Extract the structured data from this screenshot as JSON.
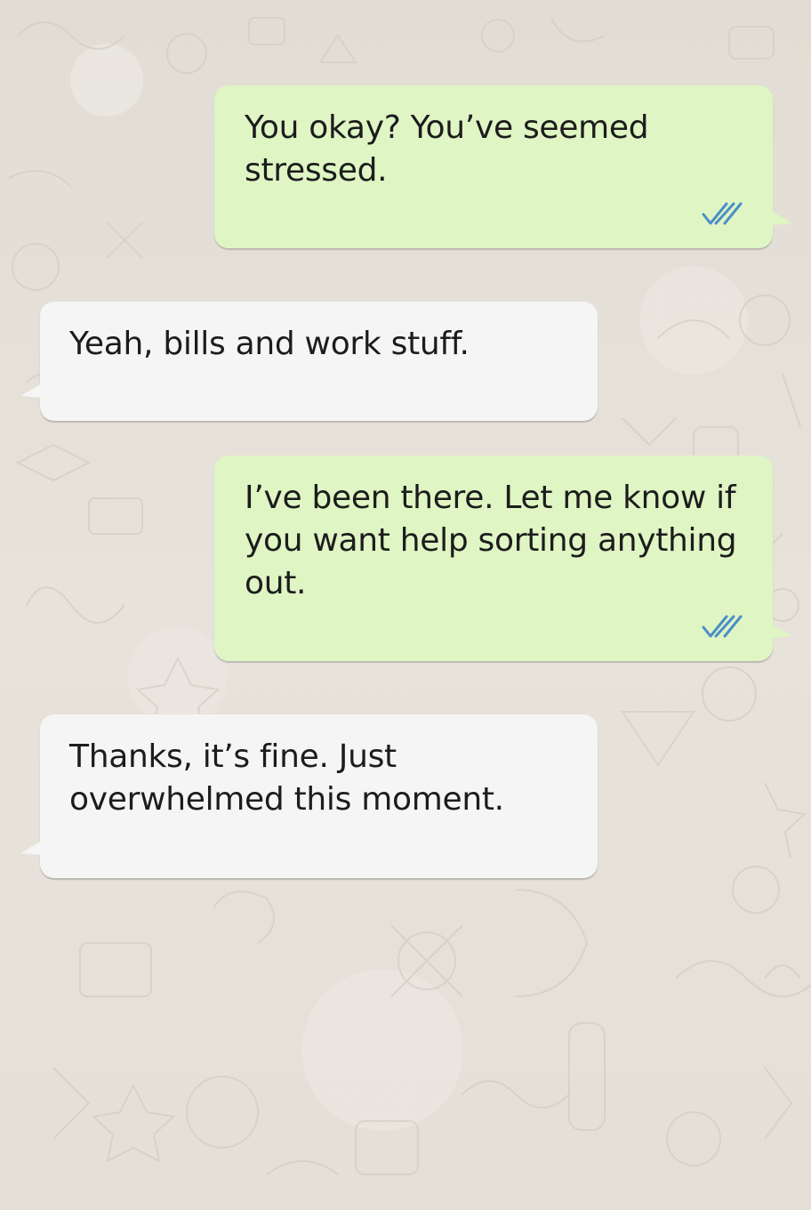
{
  "chat": {
    "messages": [
      {
        "direction": "outgoing",
        "text": "You okay? You’ve seemed stressed.",
        "status_icon": "double-check-icon"
      },
      {
        "direction": "incoming",
        "text": "Yeah, bills and work stuff."
      },
      {
        "direction": "outgoing",
        "text": "I’ve been there. Let me know if you want help sorting anything out.",
        "status_icon": "double-check-icon"
      },
      {
        "direction": "incoming",
        "text": "Thanks, it’s fine. Just overwhelmed this moment."
      }
    ]
  },
  "colors": {
    "outgoing_bubble": "#dff5c4",
    "incoming_bubble": "#f5f5f5",
    "read_ticks": "#4a8fc7",
    "wallpaper": "#e6e1d9"
  }
}
